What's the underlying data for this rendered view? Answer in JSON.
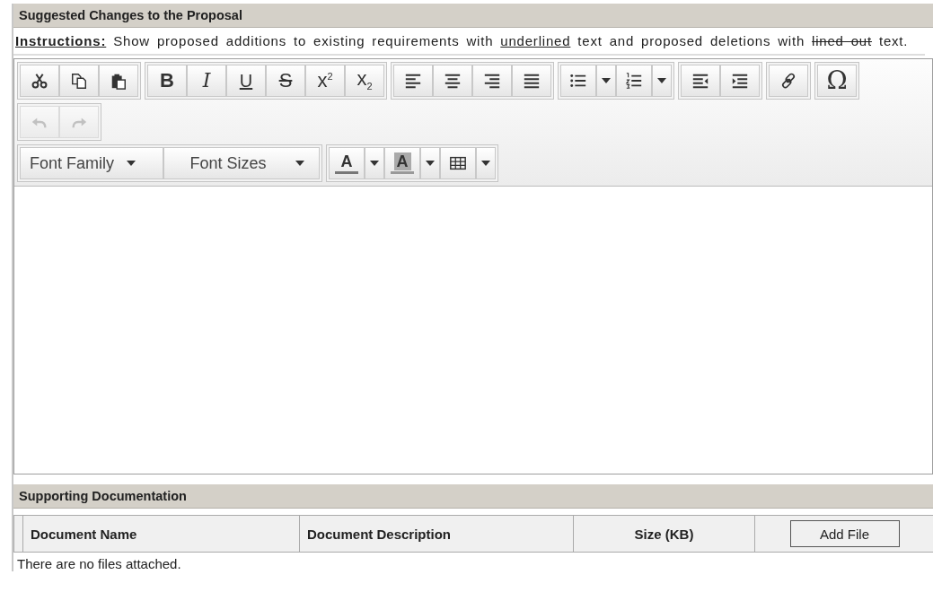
{
  "section_title": "Suggested Changes to the Proposal",
  "instructions": [
    {
      "kind": "label",
      "text": "Instructions:"
    },
    {
      "kind": "plain",
      "text": " Show proposed additions to existing requirements with "
    },
    {
      "kind": "underline",
      "text": "underlined"
    },
    {
      "kind": "plain",
      "text": " text and proposed deletions with "
    },
    {
      "kind": "strike",
      "text": "lined out"
    },
    {
      "kind": "plain",
      "text": " text."
    }
  ],
  "toolbar_rows": [
    [
      [
        {
          "kind": "cut",
          "disabled": false
        },
        {
          "kind": "copy",
          "disabled": false
        },
        {
          "kind": "paste",
          "disabled": false
        }
      ],
      [
        {
          "kind": "bold",
          "label": "B",
          "disabled": false
        },
        {
          "kind": "italic",
          "label": "I",
          "disabled": false
        },
        {
          "kind": "underline",
          "label": "U",
          "disabled": false
        },
        {
          "kind": "strikethrough",
          "label": "S",
          "disabled": false
        },
        {
          "kind": "superscript",
          "label": "x$^{2}$",
          "disabled": false
        },
        {
          "kind": "subscript",
          "label": "x$_{2}$",
          "disabled": false
        }
      ],
      [
        {
          "kind": "align-left",
          "disabled": false
        },
        {
          "kind": "align-center",
          "disabled": false
        },
        {
          "kind": "align-right",
          "disabled": false
        },
        {
          "kind": "justify",
          "disabled": false
        }
      ],
      [
        {
          "kind": "bullet-list",
          "disabled": false
        },
        {
          "kind": "caret",
          "disabled": false
        },
        {
          "kind": "number-list",
          "disabled": false
        },
        {
          "kind": "caret",
          "disabled": false
        }
      ],
      [
        {
          "kind": "outdent",
          "disabled": false
        },
        {
          "kind": "indent",
          "disabled": false
        }
      ],
      [
        {
          "kind": "link",
          "disabled": false
        }
      ],
      [
        {
          "kind": "special-char",
          "label": "Ω",
          "disabled": false
        }
      ]
    ],
    [
      [
        {
          "kind": "undo",
          "disabled": true
        },
        {
          "kind": "redo",
          "disabled": true
        }
      ]
    ],
    [
      [
        {
          "kind": "listbox",
          "label": "Font Family",
          "disabled": false
        },
        {
          "kind": "listbox",
          "label": "Font Sizes",
          "disabled": false
        }
      ],
      [
        {
          "kind": "text-color",
          "label": "A",
          "color": "#777777",
          "disabled": false
        },
        {
          "kind": "caret",
          "disabled": false
        },
        {
          "kind": "background-color",
          "label": "A",
          "color": "#999999",
          "disabled": false
        },
        {
          "kind": "caret",
          "disabled": false
        },
        {
          "kind": "table",
          "disabled": false
        },
        {
          "kind": "caret",
          "disabled": false
        }
      ]
    ]
  ],
  "documents": {
    "title": "Supporting Documentation",
    "columns": [
      {
        "kind": "text",
        "label": "Document Name"
      },
      {
        "kind": "text",
        "label": "Document Description"
      },
      {
        "kind": "text",
        "label": "Size (KB)"
      },
      {
        "kind": "button",
        "label": "Add File"
      }
    ],
    "empty_message": "There are no files attached."
  }
}
